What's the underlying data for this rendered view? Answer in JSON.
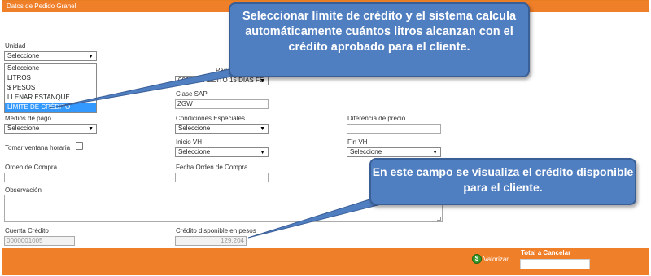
{
  "header": {
    "title": "Datos de Pedido Granel"
  },
  "form": {
    "unidad": {
      "label": "Unidad",
      "value": "Seleccione",
      "options": [
        "Seleccione",
        "LITROS",
        "$ PESOS",
        "LLENAR ESTANQUE",
        "LÍMITE DE CRÉDITO"
      ],
      "highlighted": "LÍMITE DE CRÉDITO"
    },
    "condicion_pago": {
      "label_partial": "Pago",
      "value": "0065 - CRÉDITO 15 DÍAS FE"
    },
    "clase_sap": {
      "label": "Clase SAP",
      "value": "ZGW"
    },
    "medios_pago": {
      "label": "Medios de pago",
      "value": "Seleccione"
    },
    "condiciones_especiales": {
      "label": "Condiciones Especiales",
      "value": "Seleccione"
    },
    "diferencia_precio": {
      "label": "Diferencia de precio",
      "value": ""
    },
    "tomar_ventana": {
      "label": "Tomar ventana horaria",
      "checked": false
    },
    "inicio_vh": {
      "label": "Inicio VH",
      "value": "Seleccione"
    },
    "fin_vh": {
      "label": "Fin VH",
      "value": "Seleccione"
    },
    "orden_compra": {
      "label": "Orden de Compra",
      "value": ""
    },
    "fecha_orden_compra": {
      "label": "Fecha Orden de Compra",
      "value": ""
    },
    "observacion": {
      "label": "Observación",
      "value": ""
    },
    "cuenta_credito": {
      "label": "Cuenta Crédito",
      "value": "0000001005"
    },
    "credito_disponible": {
      "label": "Crédito disponible en pesos",
      "value": "129.204"
    }
  },
  "footer": {
    "valorizar_label": "Valorizar",
    "valorizar_icon": "$",
    "total_label": "Total a Cancelar",
    "total_value": ""
  },
  "callouts": {
    "credit_limit": "Seleccionar límite de crédito  y el sistema calcula automáticamente cuántos litros alcanzan con el crédito aprobado para el cliente.",
    "available_credit": "En este campo se visualiza el crédito disponible para el cliente."
  },
  "colors": {
    "orange": "#f07f2a",
    "callout_blue": "#4f7ec1",
    "highlight_blue": "#3399ff",
    "coin_green": "#3a9b2c"
  }
}
